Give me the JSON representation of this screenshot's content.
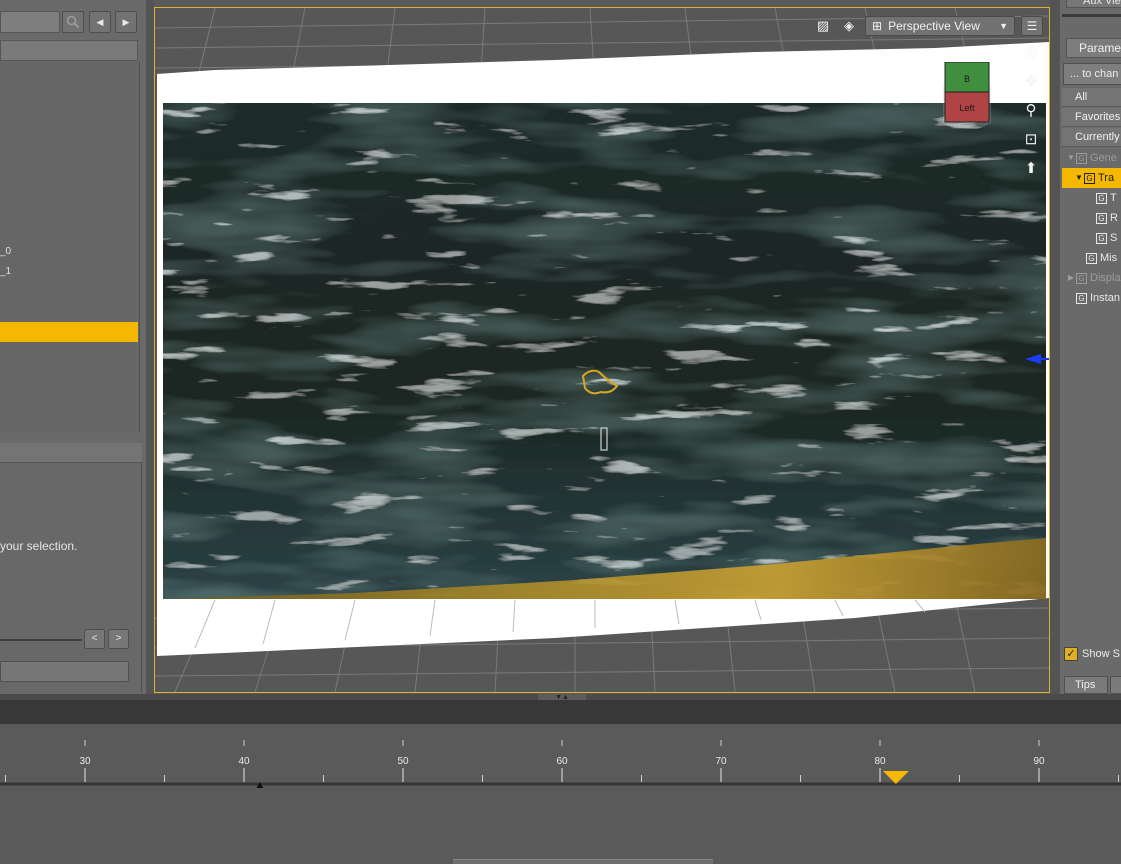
{
  "left_pane": {
    "nav_back": "◀",
    "nav_forward": "▶",
    "list_items": [
      "_0",
      "_1"
    ],
    "selection_hint": "your selection.",
    "page_prev": "<",
    "page_next": ">"
  },
  "viewport": {
    "view_mode": "Perspective View",
    "nav_cube_top": "B",
    "nav_cube_face": "Left"
  },
  "right_pane": {
    "aux_tab": "Aux View",
    "tab_label": "Paramet",
    "filter_placeholder": "... to chan",
    "filters": [
      "All",
      "Favorites",
      "Currently"
    ],
    "tree": [
      {
        "label": "Gene",
        "level": 0,
        "expander": "▼",
        "state": "dim"
      },
      {
        "label": "Tra",
        "level": 1,
        "expander": "▼",
        "state": "selected"
      },
      {
        "label": "T",
        "level": 2,
        "expander": "",
        "state": "normal"
      },
      {
        "label": "R",
        "level": 2,
        "expander": "",
        "state": "normal"
      },
      {
        "label": "S",
        "level": 2,
        "expander": "",
        "state": "normal"
      },
      {
        "label": "Mis",
        "level": 1,
        "expander": "",
        "state": "normal"
      },
      {
        "label": "Displa",
        "level": 0,
        "expander": "▶",
        "state": "dim"
      },
      {
        "label": "Instan",
        "level": 0,
        "expander": "",
        "state": "normal"
      }
    ],
    "show_label": "Show S",
    "show_checked": true,
    "tips_tab": "Tips"
  },
  "timeline": {
    "ticks": [
      "30",
      "40",
      "50",
      "60",
      "70",
      "80",
      "90"
    ],
    "current_frame": 81,
    "range_start_marker": 41,
    "accent_color": "#f5b800"
  }
}
